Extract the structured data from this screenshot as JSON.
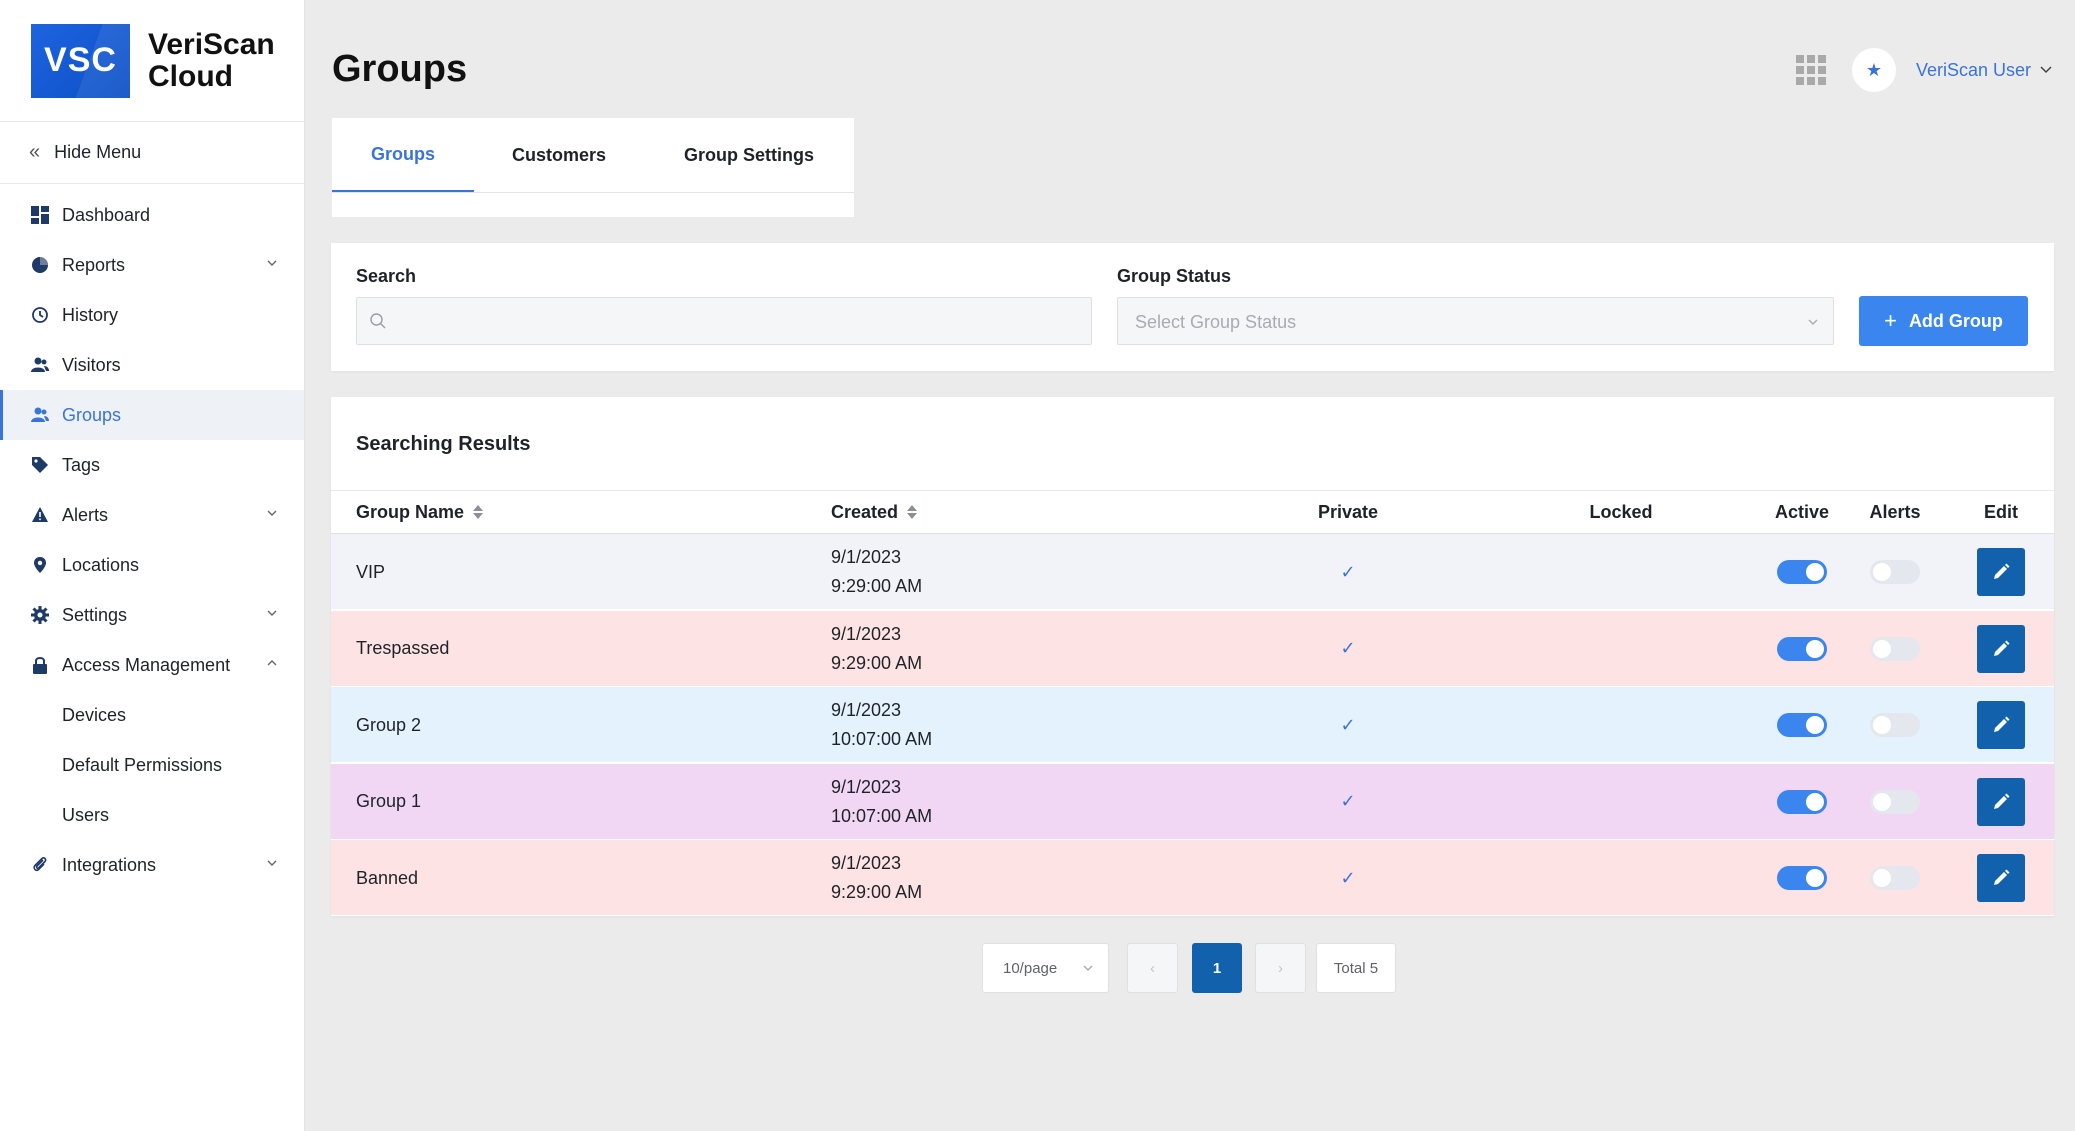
{
  "brand": {
    "logo": "VSC",
    "name_line1": "VeriScan",
    "name_line2": "Cloud"
  },
  "sidebar": {
    "hide_menu": "Hide Menu",
    "items": [
      {
        "label": "Dashboard",
        "icon": "dashboard-icon"
      },
      {
        "label": "Reports",
        "icon": "pie-chart-icon",
        "expandable": true
      },
      {
        "label": "History",
        "icon": "history-icon"
      },
      {
        "label": "Visitors",
        "icon": "users-icon"
      },
      {
        "label": "Groups",
        "icon": "users-icon",
        "active": true
      },
      {
        "label": "Tags",
        "icon": "tag-icon"
      },
      {
        "label": "Alerts",
        "icon": "warning-icon",
        "expandable": true
      },
      {
        "label": "Locations",
        "icon": "location-pin-icon"
      },
      {
        "label": "Settings",
        "icon": "gear-icon",
        "expandable": true
      },
      {
        "label": "Access Management",
        "icon": "lock-icon",
        "expanded": true
      }
    ],
    "sub_items": [
      "Devices",
      "Default Permissions",
      "Users"
    ],
    "integrations": {
      "label": "Integrations",
      "icon": "paperclip-icon"
    }
  },
  "header": {
    "title": "Groups",
    "user_name": "VeriScan User"
  },
  "tabs": [
    "Groups",
    "Customers",
    "Group Settings"
  ],
  "filters": {
    "search_label": "Search",
    "search_value": "",
    "status_label": "Group Status",
    "status_placeholder": "Select Group Status",
    "add_button": "Add Group"
  },
  "results": {
    "title": "Searching Results",
    "columns": {
      "name": "Group Name",
      "created": "Created",
      "private": "Private",
      "locked": "Locked",
      "active": "Active",
      "alerts": "Alerts",
      "edit": "Edit"
    },
    "rows": [
      {
        "name": "VIP",
        "date": "9/1/2023",
        "time": "9:29:00 AM",
        "private": true,
        "locked": false,
        "active": true,
        "alerts": false,
        "color": "#f2f3f9"
      },
      {
        "name": "Trespassed",
        "date": "9/1/2023",
        "time": "9:29:00 AM",
        "private": true,
        "locked": false,
        "active": true,
        "alerts": false,
        "color": "#fde3e3"
      },
      {
        "name": "Group 2",
        "date": "9/1/2023",
        "time": "10:07:00 AM",
        "private": true,
        "locked": false,
        "active": true,
        "alerts": false,
        "color": "#e3f2fd"
      },
      {
        "name": "Group 1",
        "date": "9/1/2023",
        "time": "10:07:00 AM",
        "private": true,
        "locked": false,
        "active": true,
        "alerts": false,
        "color": "#f1d7f4"
      },
      {
        "name": "Banned",
        "date": "9/1/2023",
        "time": "9:29:00 AM",
        "private": true,
        "locked": false,
        "active": true,
        "alerts": false,
        "color": "#fde3e3"
      }
    ]
  },
  "pagination": {
    "page_size": "10/page",
    "current_page": "1",
    "total": "Total 5"
  },
  "colors": {
    "accent": "#3b74d9",
    "primary_button": "#3a86ee",
    "edit_button": "#1261ad"
  }
}
